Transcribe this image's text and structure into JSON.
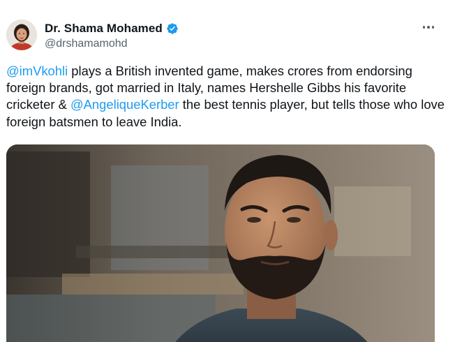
{
  "tweet": {
    "author": {
      "display_name": "Dr. Shama Mohamed",
      "handle": "@drshamamohd",
      "verified": true
    },
    "more_icon": "more-horizontal-icon",
    "text": {
      "mention_1": "@imVkohli",
      "part_1": " plays a British invented game, makes crores from endorsing foreign brands, got married in Italy, names Hershelle Gibbs his favorite cricketer & ",
      "mention_2": "@AngeliqueKerber",
      "part_2": " the best tennis player, but tells those who love foreign batsmen to leave India."
    },
    "media": {
      "type": "image"
    }
  },
  "colors": {
    "text": "#0f1419",
    "secondary": "#536471",
    "link": "#1d9bf0",
    "verified_badge": "#1d9bf0"
  }
}
